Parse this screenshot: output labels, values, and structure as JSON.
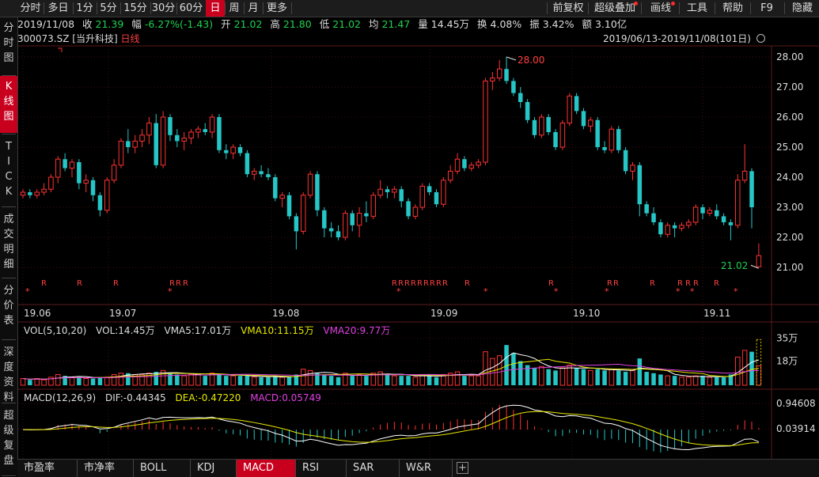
{
  "toolbar": {
    "periods": [
      "分时",
      "多日",
      "1分",
      "5分",
      "15分",
      "30分",
      "60分",
      "日",
      "周",
      "月",
      "更多"
    ],
    "active_period": "日",
    "right_buttons": [
      "前复权",
      "超级叠加",
      "画线",
      "工具",
      "帮助",
      "F9",
      "隐藏"
    ]
  },
  "sidebar": {
    "groups": [
      "分时图",
      "K线图",
      "TICK",
      "成交明细",
      "分价表",
      "深度资料",
      "超级复盘"
    ],
    "active": "K线图"
  },
  "quote": {
    "date": "2019/11/08",
    "close_label": "收",
    "close": "21.39",
    "change_label": "幅",
    "change": "-6.27%(-1.43)",
    "open_label": "开",
    "open": "21.02",
    "high_label": "高",
    "high": "21.80",
    "low_label": "低",
    "low": "21.02",
    "avg_label": "均",
    "avg": "21.47",
    "vol_label": "量",
    "vol": "14.45万",
    "turnover_label": "换",
    "turnover": "4.08%",
    "amplitude_label": "振",
    "amplitude": "3.42%",
    "amount_label": "额",
    "amount": "3.10亿"
  },
  "stock": {
    "code": "300073.SZ",
    "name": "[当升科技]",
    "period_label": "日线",
    "date_range": "2019/06/13-2019/11/08(101日)"
  },
  "volume": {
    "title": "VOL(5,10,20)",
    "vol": "VOL:14.45万",
    "vma5": "VMA5:17.01万",
    "vma10": "VMA10:11.15万",
    "vma20": "VMA20:9.77万",
    "axis_ticks": [
      "35万",
      "18万"
    ]
  },
  "macd": {
    "title": "MACD(12,26,9)",
    "dif": "DIF:-0.44345",
    "dea": "DEA:-0.47220",
    "macd": "MACD:0.05749",
    "axis_ticks": [
      "0.94608",
      "0.03914"
    ]
  },
  "chart_data": {
    "type": "candlestick",
    "price_axis": [
      28.0,
      27.0,
      26.0,
      25.0,
      24.0,
      23.0,
      22.0,
      21.0
    ],
    "x_labels": [
      "19.06",
      "19.07",
      "19.08",
      "19.09",
      "19.10",
      "19.11"
    ],
    "annotation_high": "28.00",
    "annotation_low": "21.02",
    "ohlc": [
      [
        23.4,
        23.6,
        23.3,
        23.5
      ],
      [
        23.5,
        23.6,
        23.3,
        23.4
      ],
      [
        23.4,
        23.6,
        23.3,
        23.5
      ],
      [
        23.5,
        23.8,
        23.4,
        23.6
      ],
      [
        23.6,
        24.1,
        23.5,
        24.0
      ],
      [
        24.0,
        24.7,
        23.8,
        24.6
      ],
      [
        24.6,
        24.8,
        24.2,
        24.3
      ],
      [
        24.3,
        24.6,
        24.0,
        24.5
      ],
      [
        24.5,
        24.6,
        23.6,
        23.8
      ],
      [
        23.8,
        24.1,
        23.5,
        23.9
      ],
      [
        23.9,
        24.0,
        23.2,
        23.4
      ],
      [
        23.4,
        23.5,
        22.7,
        22.9
      ],
      [
        22.9,
        24.0,
        22.8,
        23.9
      ],
      [
        23.9,
        24.6,
        23.8,
        24.4
      ],
      [
        24.4,
        25.3,
        24.3,
        25.2
      ],
      [
        25.2,
        25.6,
        24.8,
        25.0
      ],
      [
        25.0,
        25.4,
        24.8,
        25.2
      ],
      [
        25.2,
        25.6,
        25.0,
        25.4
      ],
      [
        25.4,
        26.0,
        25.1,
        25.8
      ],
      [
        25.8,
        26.1,
        24.3,
        24.4
      ],
      [
        24.4,
        26.2,
        24.3,
        26.0
      ],
      [
        26.0,
        26.1,
        25.2,
        25.4
      ],
      [
        25.4,
        25.6,
        25.0,
        25.2
      ],
      [
        25.2,
        25.5,
        24.9,
        25.3
      ],
      [
        25.3,
        25.6,
        25.1,
        25.5
      ],
      [
        25.5,
        25.7,
        25.3,
        25.6
      ],
      [
        25.6,
        25.8,
        25.4,
        25.5
      ],
      [
        25.5,
        26.1,
        25.3,
        26.0
      ],
      [
        26.0,
        26.1,
        24.8,
        24.9
      ],
      [
        24.9,
        25.1,
        24.6,
        24.8
      ],
      [
        24.8,
        25.1,
        24.6,
        25.0
      ],
      [
        25.0,
        25.1,
        24.7,
        24.8
      ],
      [
        24.8,
        24.9,
        24.0,
        24.1
      ],
      [
        24.1,
        24.3,
        23.9,
        24.2
      ],
      [
        24.2,
        24.4,
        24.0,
        24.1
      ],
      [
        24.1,
        24.3,
        23.9,
        24.0
      ],
      [
        24.0,
        24.1,
        23.2,
        23.3
      ],
      [
        23.3,
        23.5,
        23.0,
        23.4
      ],
      [
        23.4,
        23.5,
        22.6,
        22.7
      ],
      [
        22.7,
        22.8,
        21.6,
        22.2
      ],
      [
        22.2,
        23.5,
        22.1,
        23.4
      ],
      [
        23.4,
        24.2,
        23.3,
        24.1
      ],
      [
        24.1,
        24.2,
        22.7,
        22.9
      ],
      [
        22.9,
        23.0,
        22.0,
        22.3
      ],
      [
        22.3,
        22.5,
        22.0,
        22.2
      ],
      [
        22.2,
        22.4,
        21.9,
        22.0
      ],
      [
        22.0,
        22.9,
        21.9,
        22.8
      ],
      [
        22.8,
        22.9,
        22.2,
        22.4
      ],
      [
        22.4,
        23.0,
        22.0,
        22.8
      ],
      [
        22.8,
        23.2,
        22.5,
        22.7
      ],
      [
        22.7,
        23.5,
        22.6,
        23.4
      ],
      [
        23.4,
        23.9,
        23.3,
        23.6
      ],
      [
        23.6,
        23.7,
        23.3,
        23.5
      ],
      [
        23.5,
        23.7,
        23.3,
        23.6
      ],
      [
        23.6,
        23.7,
        23.0,
        23.2
      ],
      [
        23.2,
        23.3,
        22.6,
        22.7
      ],
      [
        22.7,
        23.1,
        22.6,
        23.0
      ],
      [
        23.0,
        23.8,
        22.9,
        23.7
      ],
      [
        23.7,
        23.8,
        23.4,
        23.5
      ],
      [
        23.5,
        23.6,
        23.0,
        23.1
      ],
      [
        23.1,
        24.0,
        23.0,
        23.9
      ],
      [
        23.9,
        24.4,
        23.8,
        24.2
      ],
      [
        24.2,
        24.8,
        24.1,
        24.6
      ],
      [
        24.6,
        24.7,
        24.2,
        24.3
      ],
      [
        24.3,
        24.5,
        24.2,
        24.4
      ],
      [
        24.4,
        24.6,
        24.3,
        24.5
      ],
      [
        24.5,
        27.3,
        24.4,
        27.2
      ],
      [
        27.2,
        27.5,
        26.9,
        27.3
      ],
      [
        27.3,
        27.9,
        27.2,
        27.6
      ],
      [
        27.6,
        28.0,
        27.1,
        27.2
      ],
      [
        27.2,
        27.3,
        26.7,
        26.8
      ],
      [
        26.8,
        27.0,
        26.3,
        26.5
      ],
      [
        26.5,
        26.6,
        25.8,
        25.9
      ],
      [
        25.9,
        26.0,
        25.3,
        25.4
      ],
      [
        25.4,
        26.1,
        25.3,
        26.0
      ],
      [
        26.0,
        26.1,
        25.4,
        25.5
      ],
      [
        25.5,
        25.6,
        24.9,
        25.0
      ],
      [
        25.0,
        25.9,
        24.9,
        25.8
      ],
      [
        25.8,
        26.8,
        25.7,
        26.7
      ],
      [
        26.7,
        26.8,
        26.1,
        26.2
      ],
      [
        26.2,
        26.3,
        25.6,
        25.7
      ],
      [
        25.7,
        26.0,
        25.5,
        25.9
      ],
      [
        25.9,
        26.0,
        24.9,
        25.0
      ],
      [
        25.0,
        25.2,
        24.8,
        24.9
      ],
      [
        24.9,
        25.7,
        24.8,
        25.6
      ],
      [
        25.6,
        25.7,
        24.8,
        24.9
      ],
      [
        24.9,
        25.0,
        24.1,
        24.2
      ],
      [
        24.2,
        24.5,
        23.9,
        24.4
      ],
      [
        24.4,
        24.5,
        22.7,
        23.1
      ],
      [
        23.1,
        23.2,
        22.7,
        22.8
      ],
      [
        22.8,
        23.0,
        22.4,
        22.5
      ],
      [
        22.5,
        22.6,
        22.0,
        22.1
      ],
      [
        22.1,
        22.5,
        22.0,
        22.4
      ],
      [
        22.4,
        22.5,
        22.0,
        22.3
      ],
      [
        22.3,
        22.5,
        22.2,
        22.4
      ],
      [
        22.4,
        22.6,
        22.3,
        22.5
      ],
      [
        22.5,
        23.1,
        22.4,
        23.0
      ],
      [
        23.0,
        23.1,
        22.6,
        22.8
      ],
      [
        22.8,
        23.0,
        22.7,
        22.9
      ],
      [
        22.9,
        23.1,
        22.6,
        22.7
      ],
      [
        22.7,
        22.8,
        22.4,
        22.5
      ],
      [
        22.5,
        22.6,
        21.9,
        22.4
      ],
      [
        22.4,
        24.1,
        22.3,
        23.9
      ],
      [
        23.9,
        25.1,
        23.8,
        24.2
      ],
      [
        24.2,
        24.3,
        22.3,
        23.0
      ],
      [
        21.02,
        21.8,
        21.02,
        21.39
      ]
    ],
    "volumes": [
      5,
      4,
      5,
      4,
      6,
      8,
      7,
      6,
      6,
      5,
      5,
      6,
      6,
      8,
      9,
      9,
      8,
      8,
      9,
      10,
      11,
      9,
      8,
      7,
      8,
      8,
      7,
      9,
      8,
      7,
      7,
      7,
      7,
      6,
      6,
      6,
      7,
      6,
      6,
      8,
      12,
      11,
      9,
      8,
      7,
      6,
      9,
      7,
      8,
      7,
      9,
      10,
      8,
      7,
      7,
      7,
      6,
      8,
      7,
      6,
      8,
      9,
      10,
      7,
      7,
      7,
      25,
      20,
      22,
      30,
      24,
      18,
      15,
      13,
      14,
      12,
      11,
      13,
      15,
      13,
      12,
      11,
      12,
      11,
      12,
      11,
      10,
      11,
      20,
      10,
      9,
      8,
      7,
      7,
      6,
      6,
      7,
      7,
      6,
      6,
      6,
      8,
      21,
      26,
      25,
      14.45
    ],
    "markers": [
      "R",
      "R",
      "R",
      "R",
      "R",
      "R",
      "R",
      "R",
      "R",
      "R",
      "R",
      "R",
      "R",
      "R",
      "R",
      "R",
      "R",
      "R",
      "R",
      "R",
      "R",
      "R",
      "R",
      "R",
      "R",
      "R",
      "R"
    ]
  }
}
